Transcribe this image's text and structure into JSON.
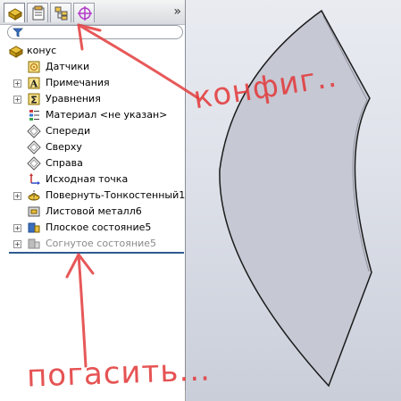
{
  "feature_tree": {
    "filter_placeholder": "",
    "root_label": "конус",
    "items": [
      {
        "label": "Датчики",
        "expandable": false,
        "icon": "sensor-icon"
      },
      {
        "label": "Примечания",
        "expandable": true,
        "icon": "annotations-icon"
      },
      {
        "label": "Уравнения",
        "expandable": true,
        "icon": "equations-icon"
      },
      {
        "label": "Материал <не указан>",
        "expandable": false,
        "icon": "material-icon"
      },
      {
        "label": "Спереди",
        "expandable": false,
        "icon": "plane-icon"
      },
      {
        "label": "Сверху",
        "expandable": false,
        "icon": "plane-icon"
      },
      {
        "label": "Справа",
        "expandable": false,
        "icon": "plane-icon"
      },
      {
        "label": "Исходная точка",
        "expandable": false,
        "icon": "origin-icon"
      },
      {
        "label": "Повернуть-Тонкостенный1",
        "expandable": true,
        "icon": "revolve-icon"
      },
      {
        "label": "Листовой металл6",
        "expandable": false,
        "icon": "sheet-metal-icon"
      },
      {
        "label": "Плоское состояние5",
        "expandable": true,
        "icon": "flat-pattern-icon"
      },
      {
        "label": "Согнутое состояние5",
        "expandable": true,
        "icon": "bent-state-icon",
        "suppressed": true
      }
    ],
    "toggle_glyph": "»"
  },
  "annotations": {
    "top_text": "конфиг..",
    "bottom_text": "погасить..."
  },
  "colors": {
    "accent": "#2f5a93",
    "annotation": "#e33c3c",
    "part_fill": "#c6c8d4"
  }
}
